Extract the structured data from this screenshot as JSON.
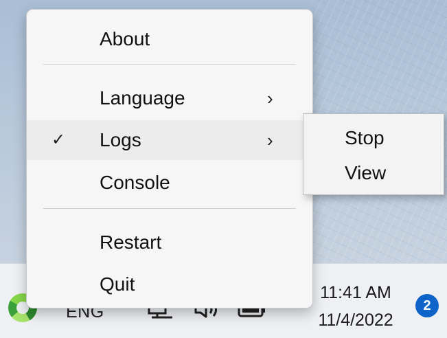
{
  "context_menu": {
    "items": {
      "about": "About",
      "language": "Language",
      "logs": "Logs",
      "console": "Console",
      "restart": "Restart",
      "quit": "Quit"
    },
    "checkmark": "✓",
    "chevron": "›",
    "highlighted_item": "Logs",
    "checked_item": "Logs"
  },
  "submenu": {
    "items": {
      "stop": "Stop",
      "view": "View"
    }
  },
  "taskbar": {
    "language": "ENG",
    "time": "11:41 AM",
    "date": "11/4/2022",
    "notification_count": "2",
    "icons": [
      "app-tray-icon",
      "network-icon",
      "volume-icon",
      "battery-icon"
    ]
  },
  "colors": {
    "badge": "#0d63c7",
    "menu_background": "#f6f6f6",
    "highlight": "#ececec",
    "taskbar": "#eef0f3"
  }
}
